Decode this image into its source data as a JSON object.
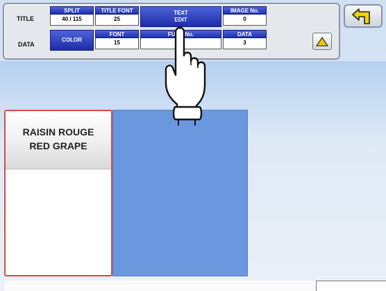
{
  "panel": {
    "title_row_label": "TITLE",
    "data_row_label": "DATA",
    "split": {
      "label": "SPLIT",
      "value": "40 / 115"
    },
    "title_font": {
      "label": "TITLE FONT",
      "value": "25"
    },
    "text_edit": {
      "line1": "TEXT",
      "line2": "EDIT"
    },
    "image_no": {
      "label": "IMAGE No.",
      "value": "0"
    },
    "color_button": "COLOR",
    "font": {
      "label": "FONT",
      "value": "15"
    },
    "func_no": {
      "label": "FUNC No.",
      "value": "1"
    },
    "data": {
      "label": "DATA",
      "value": "3"
    },
    "up_icon": "triangle-up",
    "back_icon": "return-arrow"
  },
  "item": {
    "line1": "RAISIN ROUGE",
    "line2": "RED GRAPE"
  },
  "colors": {
    "button_blue": "#1f2fae",
    "label_blue": "#6b97df",
    "selected_border": "#d84a4a",
    "up_triangle": "#f0c400"
  }
}
